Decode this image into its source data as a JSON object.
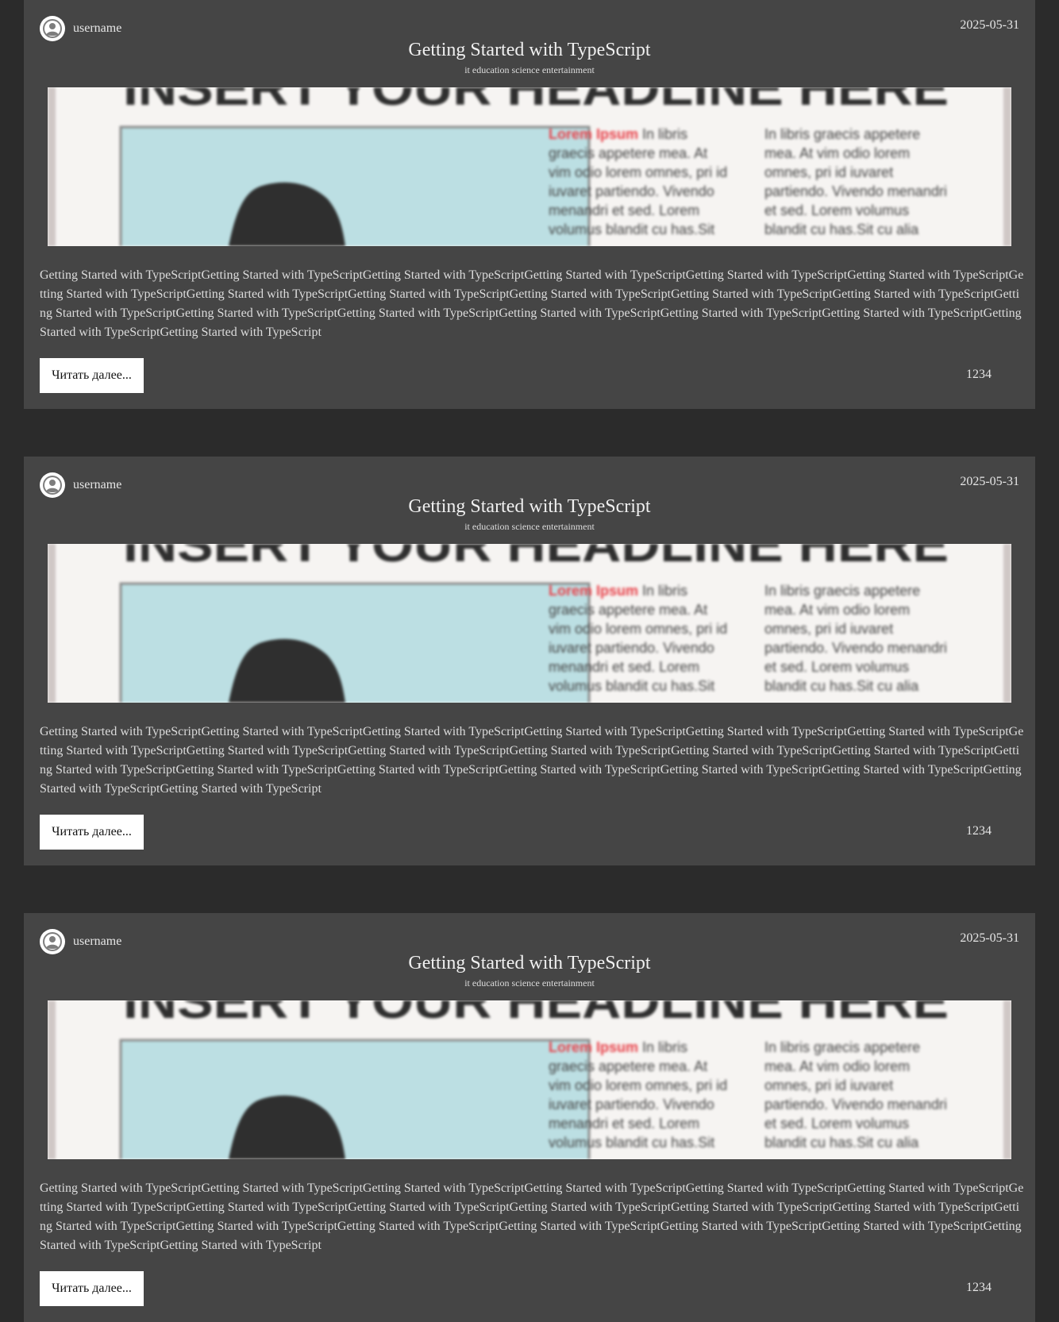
{
  "posts": [
    {
      "username": "username",
      "date": "2025-05-31",
      "title": "Getting Started with TypeScript",
      "tags": "it education science entertainment",
      "excerpt": "Getting Started with TypeScriptGetting Started with TypeScriptGetting Started with TypeScriptGetting Started with TypeScriptGetting Started with TypeScriptGetting Started with TypeScriptGetting Started with TypeScriptGetting Started with TypeScriptGetting Started with TypeScriptGetting Started with TypeScriptGetting Started with TypeScriptGetting Started with TypeScriptGetting Started with TypeScriptGetting Started with TypeScriptGetting Started with TypeScriptGetting Started with TypeScriptGetting Started with TypeScriptGetting Started with TypeScriptGetting Started with TypeScriptGetting Started with TypeScript",
      "read_more": "Читать далее...",
      "views": "1234",
      "banner": {
        "headline": "INSERT YOUR HEADLINE HERE",
        "col1_lead": "Lorem Ipsum",
        "col1_lines": [
          " In libris",
          "graecis appetere mea. At",
          "vim odio lorem omnes, pri id",
          "iuvaret partiendo. Vivendo",
          "menandri et sed. Lorem",
          "volumus blandit cu has.Sit"
        ],
        "col2_lines": [
          "In libris graecis appetere",
          "mea. At vim odio lorem",
          "omnes, pri id iuvaret",
          "partiendo. Vivendo menandri",
          "et sed. Lorem volumus",
          "blandit cu has.Sit cu alia"
        ]
      }
    },
    {
      "username": "username",
      "date": "2025-05-31",
      "title": "Getting Started with TypeScript",
      "tags": "it education science entertainment",
      "excerpt": "Getting Started with TypeScriptGetting Started with TypeScriptGetting Started with TypeScriptGetting Started with TypeScriptGetting Started with TypeScriptGetting Started with TypeScriptGetting Started with TypeScriptGetting Started with TypeScriptGetting Started with TypeScriptGetting Started with TypeScriptGetting Started with TypeScriptGetting Started with TypeScriptGetting Started with TypeScriptGetting Started with TypeScriptGetting Started with TypeScriptGetting Started with TypeScriptGetting Started with TypeScriptGetting Started with TypeScriptGetting Started with TypeScriptGetting Started with TypeScript",
      "read_more": "Читать далее...",
      "views": "1234",
      "banner": {
        "headline": "INSERT YOUR HEADLINE HERE",
        "col1_lead": "Lorem Ipsum",
        "col1_lines": [
          " In libris",
          "graecis appetere mea. At",
          "vim odio lorem omnes, pri id",
          "iuvaret partiendo. Vivendo",
          "menandri et sed. Lorem",
          "volumus blandit cu has.Sit"
        ],
        "col2_lines": [
          "In libris graecis appetere",
          "mea. At vim odio lorem",
          "omnes, pri id iuvaret",
          "partiendo. Vivendo menandri",
          "et sed. Lorem volumus",
          "blandit cu has.Sit cu alia"
        ]
      }
    },
    {
      "username": "username",
      "date": "2025-05-31",
      "title": "Getting Started with TypeScript",
      "tags": "it education science entertainment",
      "excerpt": "Getting Started with TypeScriptGetting Started with TypeScriptGetting Started with TypeScriptGetting Started with TypeScriptGetting Started with TypeScriptGetting Started with TypeScriptGetting Started with TypeScriptGetting Started with TypeScriptGetting Started with TypeScriptGetting Started with TypeScriptGetting Started with TypeScriptGetting Started with TypeScriptGetting Started with TypeScriptGetting Started with TypeScriptGetting Started with TypeScriptGetting Started with TypeScriptGetting Started with TypeScriptGetting Started with TypeScriptGetting Started with TypeScriptGetting Started with TypeScript",
      "read_more": "Читать далее...",
      "views": "1234",
      "banner": {
        "headline": "INSERT YOUR HEADLINE HERE",
        "col1_lead": "Lorem Ipsum",
        "col1_lines": [
          " In libris",
          "graecis appetere mea. At",
          "vim odio lorem omnes, pri id",
          "iuvaret partiendo. Vivendo",
          "menandri et sed. Lorem",
          "volumus blandit cu has.Sit"
        ],
        "col2_lines": [
          "In libris graecis appetere",
          "mea. At vim odio lorem",
          "omnes, pri id iuvaret",
          "partiendo. Vivendo menandri",
          "et sed. Lorem volumus",
          "blandit cu has.Sit cu alia"
        ]
      }
    }
  ],
  "colors": {
    "page_background": "#2b2b2b",
    "card_background": "#454545",
    "button_background": "#ffffff",
    "banner_accent": "#e8424a",
    "banner_photo": "#bcdfe3"
  },
  "icons": {
    "avatar": "user-circle-icon"
  }
}
